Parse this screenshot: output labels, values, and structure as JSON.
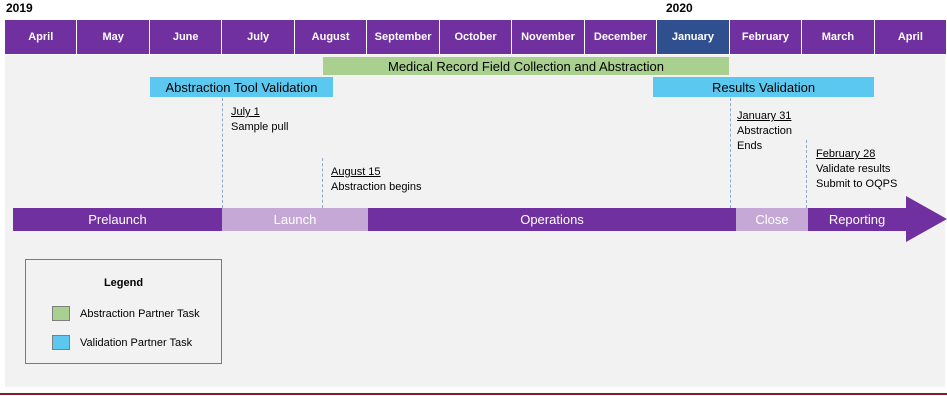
{
  "years": {
    "start": "2019",
    "next": "2020"
  },
  "months": [
    "April",
    "May",
    "June",
    "July",
    "August",
    "September",
    "October",
    "November",
    "December",
    "January",
    "February",
    "March",
    "April"
  ],
  "current_month_index": 9,
  "tasks": {
    "medical_record": "Medical Record Field Collection and Abstraction",
    "abstraction_tool": "Abstraction Tool Validation",
    "results_validation": "Results Validation"
  },
  "milestones": {
    "july1": {
      "date": "July 1",
      "lines": [
        "Sample pull"
      ]
    },
    "aug15": {
      "date": "August 15",
      "lines": [
        "Abstraction begins"
      ]
    },
    "jan31": {
      "date": "January 31",
      "lines": [
        "Abstraction",
        "Ends"
      ]
    },
    "feb28": {
      "date": "February 28",
      "lines": [
        "Validate results",
        "Submit to OQPS"
      ]
    }
  },
  "phases": {
    "prelaunch": "Prelaunch",
    "launch": "Launch",
    "operations": "Operations",
    "close": "Close",
    "reporting": "Reporting"
  },
  "legend": {
    "title": "Legend",
    "items": [
      {
        "label": "Abstraction Partner Task",
        "color": "#a9d08e"
      },
      {
        "label": "Validation Partner Task",
        "color": "#5bc8f0"
      }
    ]
  },
  "colors": {
    "purple": "#7030a0",
    "light_purple": "#c5a8d6",
    "highlight_month": "#2f4f8f",
    "green": "#a9d08e",
    "blue": "#5bc8f0"
  }
}
